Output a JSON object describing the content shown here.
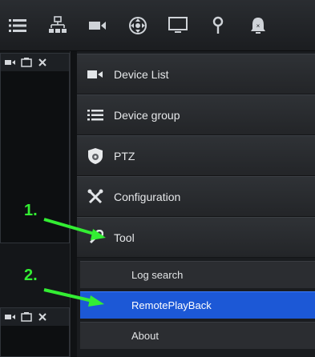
{
  "toolbar": {
    "icons": [
      "list-icon",
      "device-tree-icon",
      "camera-icon",
      "ptz-icon",
      "monitor-icon",
      "pin-icon",
      "alarm-icon"
    ]
  },
  "left_panels": {
    "icons": [
      "camera-small-icon",
      "snapshot-icon",
      "close-icon"
    ]
  },
  "menu": {
    "items": [
      {
        "label": "Device List",
        "icon": "camera-icon"
      },
      {
        "label": "Device group",
        "icon": "list-icon"
      },
      {
        "label": "PTZ",
        "icon": "ptz-shield-icon"
      },
      {
        "label": "Configuration",
        "icon": "tools-icon"
      },
      {
        "label": "Tool",
        "icon": "wrench-icon"
      }
    ],
    "submenu": [
      {
        "label": "Log search",
        "selected": false
      },
      {
        "label": "RemotePlayBack",
        "selected": true
      },
      {
        "label": "About",
        "selected": false
      }
    ]
  },
  "annotations": {
    "step1": "1.",
    "step2": "2."
  },
  "colors": {
    "annotation": "#33ee33",
    "selected": "#1c58d6",
    "background": "#101214"
  }
}
